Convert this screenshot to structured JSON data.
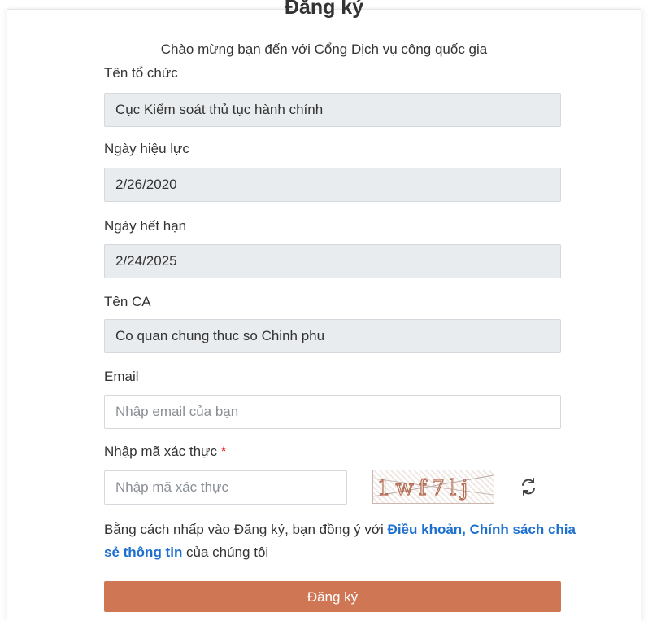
{
  "form": {
    "title": "Đăng ký",
    "subtitle": "Chào mừng bạn đến với Cổng Dịch vụ công quốc gia",
    "organization": {
      "label": "Tên tổ chức",
      "value": "Cục Kiểm soát thủ tục hành chính"
    },
    "effective_date": {
      "label": "Ngày hiệu lực",
      "value": "2/26/2020"
    },
    "expiry_date": {
      "label": "Ngày hết hạn",
      "value": "2/24/2025"
    },
    "ca_name": {
      "label": "Tên CA",
      "value": "Co quan chung thuc so Chinh phu"
    },
    "email": {
      "label": "Email",
      "placeholder": "Nhập email của bạn",
      "value": ""
    },
    "captcha": {
      "label": "Nhập mã xác thực",
      "required_mark": "*",
      "placeholder": "Nhập mã xác thực",
      "value": "",
      "image_text": "1wf7lj",
      "refresh_icon": "refresh-icon"
    },
    "terms": {
      "prefix": "Bằng cách nhấp vào Đăng ký, bạn đồng ý với ",
      "link_text": "Điều khoản, Chính sách chia sẻ thông tin",
      "suffix": " của chúng tôi"
    },
    "submit_label": "Đăng ký"
  },
  "colors": {
    "submit_button": "#cf7654",
    "link": "#1d6fd0",
    "disabled_field": "#e9ecef",
    "required": "#e02020"
  }
}
